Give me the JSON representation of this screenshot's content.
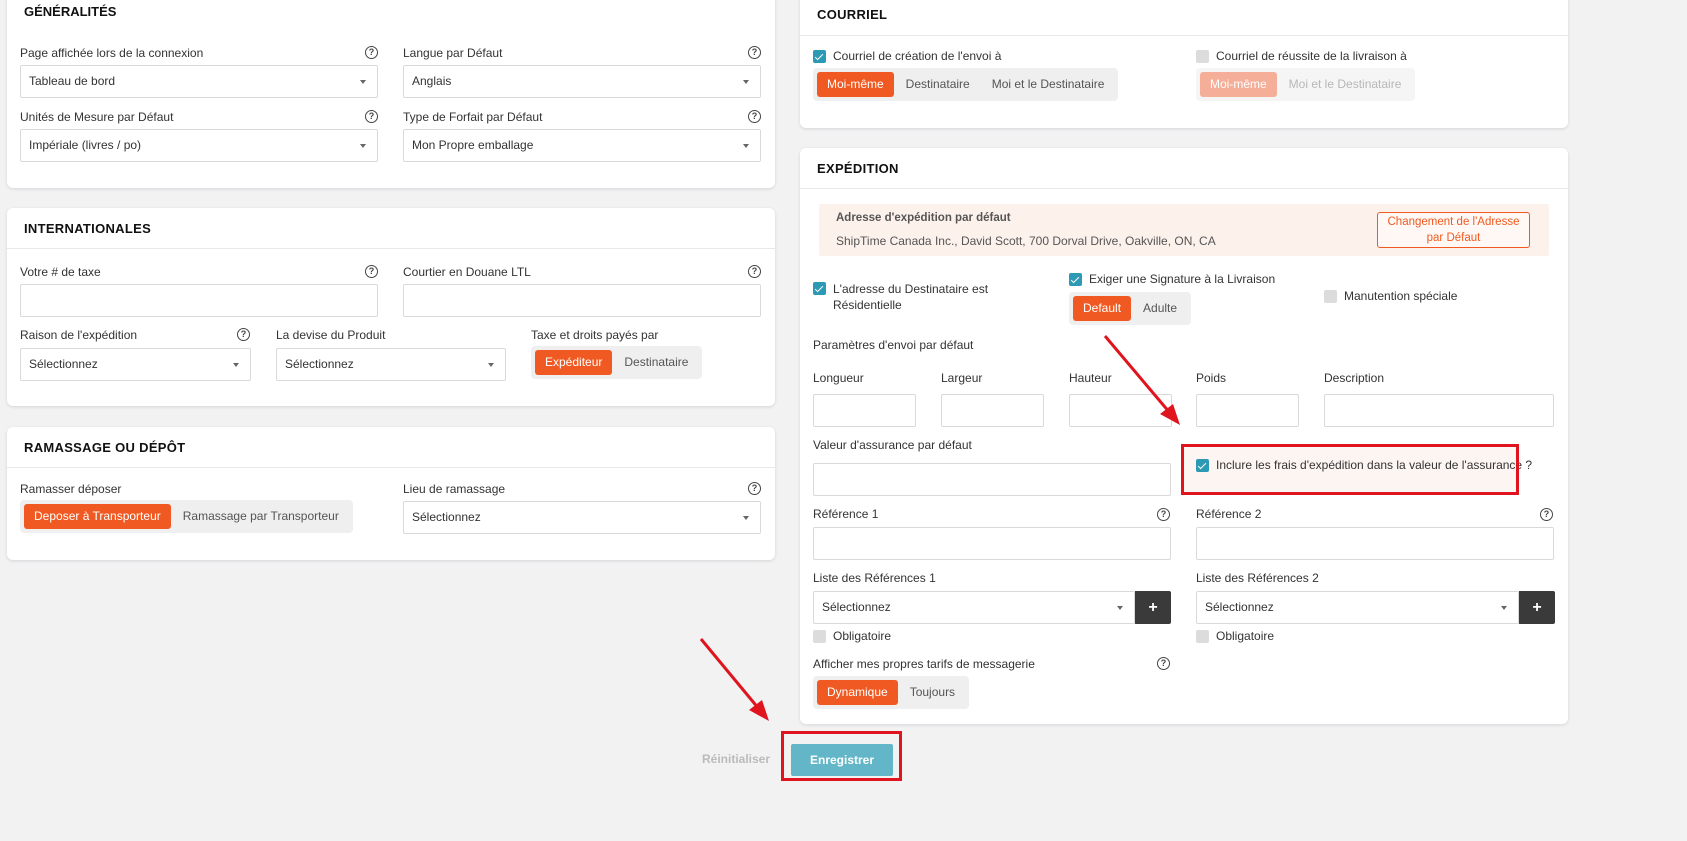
{
  "generalites": {
    "title": "GÉNÉRALITÉS",
    "page_label": "Page affichée lors de la connexion",
    "page_value": "Tableau de bord",
    "langue_label": "Langue par Défaut",
    "langue_value": "Anglais",
    "unites_label": "Unités de Mesure par Défaut",
    "unites_value": "Impériale (livres / po)",
    "forfait_label": "Type de Forfait par Défaut",
    "forfait_value": "Mon Propre emballage"
  },
  "internationales": {
    "title": "INTERNATIONALES",
    "taxe_label": "Votre # de taxe",
    "courtier_label": "Courtier en Douane LTL",
    "raison_label": "Raison de l'expédition",
    "raison_value": "Sélectionnez",
    "devise_label": "La devise du Produit",
    "devise_value": "Sélectionnez",
    "droits_label": "Taxe et droits payés par",
    "droits_options": [
      "Expéditeur",
      "Destinataire"
    ]
  },
  "ramassage": {
    "title": "RAMASSAGE OU DÉPÔT",
    "mode_label": "Ramasser déposer",
    "mode_options": [
      "Deposer à Transporteur",
      "Ramassage par Transporteur"
    ],
    "lieu_label": "Lieu de ramassage",
    "lieu_value": "Sélectionnez"
  },
  "courriel": {
    "title": "COURRIEL",
    "creation_label": "Courriel de création de l'envoi à",
    "creation_options": [
      "Moi-même",
      "Destinataire",
      "Moi et le Destinataire"
    ],
    "reussite_label": "Courriel de réussite de la livraison à",
    "reussite_options": [
      "Moi-même",
      "Moi et le Destinataire"
    ]
  },
  "expedition": {
    "title": "EXPÉDITION",
    "adresse_title": "Adresse d'expédition par défaut",
    "adresse_value": "ShipTime Canada Inc., David Scott, 700 Dorval Drive, Oakville, ON, CA",
    "adresse_button": "Changement de l'Adresse par Défaut",
    "residentielle_label": "L'adresse du Destinataire est Résidentielle",
    "signature_label": "Exiger une Signature à la Livraison",
    "signature_options": [
      "Default",
      "Adulte"
    ],
    "manutention_label": "Manutention spéciale",
    "parametres_label": "Paramètres d'envoi par défaut",
    "longueur_label": "Longueur",
    "largeur_label": "Largeur",
    "hauteur_label": "Hauteur",
    "poids_label": "Poids",
    "description_label": "Description",
    "assurance_label": "Valeur d'assurance par défaut",
    "inclure_label": "Inclure les frais d'expédition dans la valeur de l'assurance ?",
    "ref1_label": "Référence 1",
    "ref2_label": "Référence 2",
    "liste1_label": "Liste des Références 1",
    "liste1_value": "Sélectionnez",
    "liste2_label": "Liste des Références 2",
    "liste2_value": "Sélectionnez",
    "obligatoire1_label": "Obligatoire",
    "obligatoire2_label": "Obligatoire",
    "tarifs_label": "Afficher mes propres tarifs de messagerie",
    "tarifs_options": [
      "Dynamique",
      "Toujours"
    ]
  },
  "footer": {
    "reset_label": "Réinitialiser",
    "save_label": "Enregistrer"
  },
  "icons": {
    "help": "?",
    "plus": "+"
  },
  "colors": {
    "accent": "#f05a22",
    "check": "#2d9ab5",
    "save": "#62b6c7",
    "highlight": "#e0141e"
  }
}
